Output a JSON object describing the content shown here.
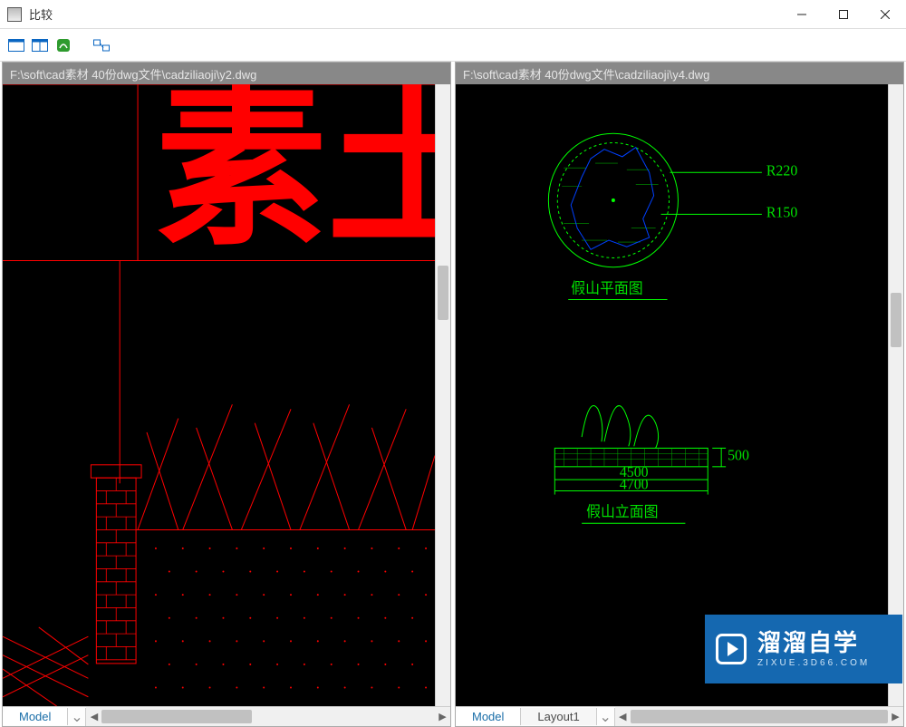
{
  "window": {
    "title": "比较"
  },
  "toolbar": {
    "icons": [
      "layout-single",
      "layout-split",
      "style-toggle",
      "link-views"
    ]
  },
  "panes": {
    "left": {
      "path": "F:\\soft\\cad素材 40份dwg文件\\cadziliaoji\\y2.dwg",
      "big_text": "素土",
      "tabs": {
        "model": "Model"
      }
    },
    "right": {
      "path": "F:\\soft\\cad素材 40份dwg文件\\cadziliaoji\\y4.dwg",
      "labels": {
        "plan": "假山平面图",
        "elevation": "假山立面图"
      },
      "dims": {
        "r1": "R220",
        "r2": "R150",
        "w1": "4500",
        "w2": "4700",
        "h1": "500"
      },
      "tabs": {
        "model": "Model",
        "layout1": "Layout1"
      }
    }
  },
  "watermark": {
    "main": "溜溜自学",
    "sub": "ZIXUE.3D66.COM"
  }
}
